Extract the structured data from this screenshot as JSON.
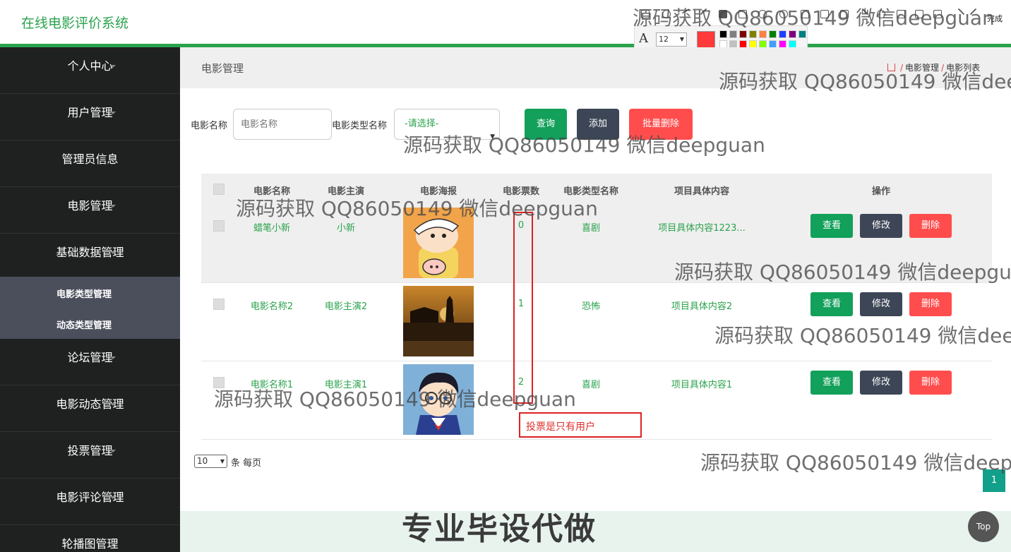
{
  "app": {
    "title": "在线电影评价系统"
  },
  "screenshot_tool": {
    "font_size": "12",
    "done_label": "完成",
    "current_color": "#ff3a3a",
    "swatches": [
      "#000000",
      "#808080",
      "#800000",
      "#808000",
      "#ff8040",
      "#008000",
      "#2040ff",
      "#800080",
      "#008080",
      "#ffffff",
      "#c0c0c0",
      "#ff0000",
      "#ffff00",
      "#80ff00",
      "#40a0ff",
      "#ff00ff",
      "#00ffff"
    ]
  },
  "sidebar": {
    "items": [
      {
        "label": "个人中心"
      },
      {
        "label": "用户管理"
      },
      {
        "label": "管理员信息"
      },
      {
        "label": "电影管理"
      },
      {
        "label": "基础数据管理"
      },
      {
        "label": "论坛管理"
      },
      {
        "label": "电影动态管理"
      },
      {
        "label": "投票管理"
      },
      {
        "label": "电影评论管理"
      },
      {
        "label": "轮播图管理"
      }
    ],
    "sub_items": [
      {
        "label": "电影类型管理"
      },
      {
        "label": "动态类型管理"
      }
    ]
  },
  "breadcrumb": {
    "page_title": "电影管理",
    "path": [
      "电影管理",
      "电影列表"
    ]
  },
  "search": {
    "name_label": "电影名称",
    "name_placeholder": "电影名称",
    "type_label": "电影类型名称",
    "type_selected": "-请选择-",
    "query_button": "查询",
    "add_button": "添加",
    "batch_delete_button": "批量删除"
  },
  "table": {
    "headers": [
      "电影名称",
      "电影主演",
      "电影海报",
      "电影票数",
      "电影类型名称",
      "项目具体内容",
      "操作"
    ],
    "rows": [
      {
        "name": "蜡笔小新",
        "star": "小新",
        "votes": "0",
        "type": "喜剧",
        "content": "项目具体内容1223..."
      },
      {
        "name": "电影名称2",
        "star": "电影主演2",
        "votes": "1",
        "type": "恐怖",
        "content": "项目具体内容2"
      },
      {
        "name": "电影名称1",
        "star": "电影主演1",
        "votes": "2",
        "type": "喜剧",
        "content": "项目具体内容1"
      }
    ],
    "actions": {
      "view": "查看",
      "edit": "修改",
      "delete": "删除"
    }
  },
  "pagination": {
    "page_size": "10",
    "per_page_label": "条 每页",
    "current_page": "1"
  },
  "annotation": {
    "text": "投票是只有用户"
  },
  "footer": {
    "banner": "专业毕设代做",
    "top_button": "Top"
  },
  "watermark": {
    "text": "源码获取 QQ86050149 微信deepguan"
  },
  "colors": {
    "accent": "#2ba24c",
    "sidebar": "#1f2020",
    "danger": "#ff4d4d",
    "primary": "#12a05a"
  }
}
